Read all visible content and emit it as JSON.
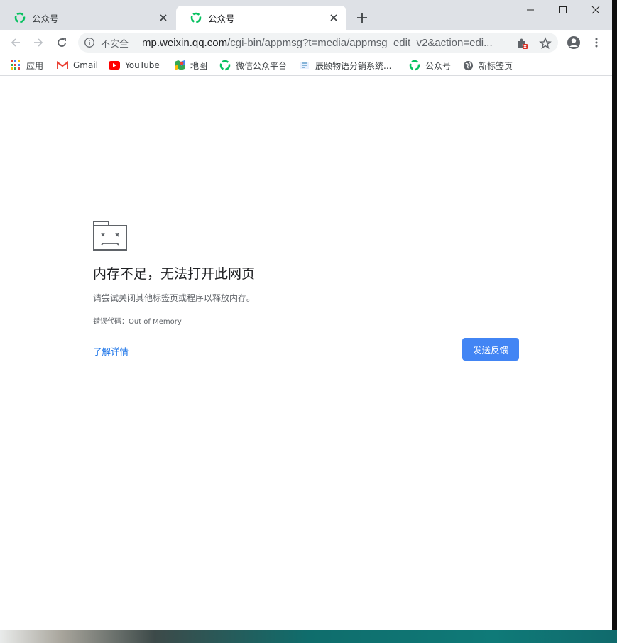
{
  "tabs": [
    {
      "title": "公众号",
      "active": false
    },
    {
      "title": "公众号",
      "active": true
    }
  ],
  "toolbar": {
    "security_label": "不安全",
    "url_host": "mp.weixin.qq.com",
    "url_rest": "/cgi-bin/appmsg?t=media/appmsg_edit_v2&action=edi..."
  },
  "bookmarks": [
    {
      "label": "应用",
      "icon": "apps-grid-icon"
    },
    {
      "label": "Gmail",
      "icon": "gmail-icon"
    },
    {
      "label": "YouTube",
      "icon": "youtube-icon"
    },
    {
      "label": "地图",
      "icon": "maps-icon"
    },
    {
      "label": "微信公众平台",
      "icon": "wechat-icon"
    },
    {
      "label": "辰颐物语分销系统...",
      "icon": "site-icon"
    },
    {
      "label": "公众号",
      "icon": "wechat-icon"
    },
    {
      "label": "新标签页",
      "icon": "globe-icon"
    }
  ],
  "error": {
    "title": "内存不足，无法打开此网页",
    "description": "请尝试关闭其他标签页或程序以释放内存。",
    "code": "错误代码：Out of Memory",
    "learn_more": "了解详情",
    "feedback_button": "发送反馈"
  },
  "colors": {
    "accent_blue": "#4285f4",
    "link_blue": "#1a73e8",
    "wechat_green": "#07c160",
    "tabstrip": "#dee1e6"
  }
}
